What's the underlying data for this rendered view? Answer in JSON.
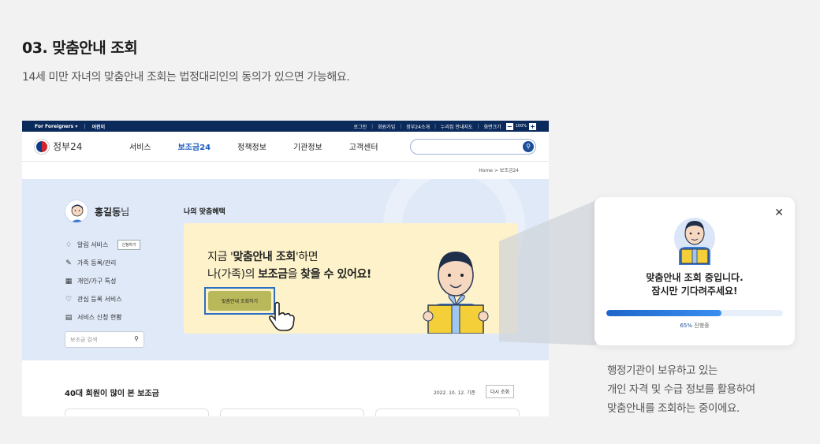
{
  "header": {
    "title": "03. 맞춤안내 조회",
    "subtitle": "14세 미만 자녀의 맞춤안내 조회는 법정대리인의 동의가 있으면 가능해요."
  },
  "utilbar": {
    "foreigners": "For Foreigners ▾",
    "other": "어린이",
    "links": [
      "로그인",
      "회원가입",
      "정부24소개",
      "누리집 안내지도",
      "화면크기"
    ],
    "zoom": "100%"
  },
  "nav": {
    "logo": "정부24",
    "menu": [
      "서비스",
      "보조금24",
      "정책정보",
      "기관정보",
      "고객센터"
    ],
    "active_index": 1
  },
  "breadcrumb": "Home  >  보조금24",
  "profile": {
    "name": "홍길동",
    "suffix": "님",
    "menu": [
      {
        "icon": "bell-icon",
        "label": "알림 서비스",
        "chip": "신청하기"
      },
      {
        "icon": "pencil-icon",
        "label": "가족 등록/관리"
      },
      {
        "icon": "building-icon",
        "label": "개인/가구 특성"
      },
      {
        "icon": "heart-icon",
        "label": "관심 등록 서비스"
      },
      {
        "icon": "document-icon",
        "label": "서비스 신청 현황"
      }
    ],
    "search_placeholder": "보조금 검색"
  },
  "benefit": {
    "title": "나의 맞춤혜택",
    "line1_pre": "지금 '",
    "line1_bold": "맞춤안내 조회",
    "line1_post": "'하면",
    "line2_pre": "나(가족)의 ",
    "line2_bold1": "보조금",
    "line2_mid": "을 ",
    "line2_bold2": "찾을 수 있어요!",
    "button": "맞춤안내 조회하기"
  },
  "popular": {
    "title": "40대 회원이 많이 본 보조금",
    "date": "2022. 10. 12. 기준",
    "refresh": "다시 조회"
  },
  "popup": {
    "line1": "맞춤안내 조회 중입니다.",
    "line2": "잠시만 기다려주세요!",
    "progress": 65,
    "progress_label": "65%",
    "progress_suffix": " 진행중"
  },
  "description": [
    "행정기관이 보유하고 있는",
    "개인 자격 및 수급 정보를 활용하여",
    "맞춤안내를 조회하는 중이에요."
  ]
}
